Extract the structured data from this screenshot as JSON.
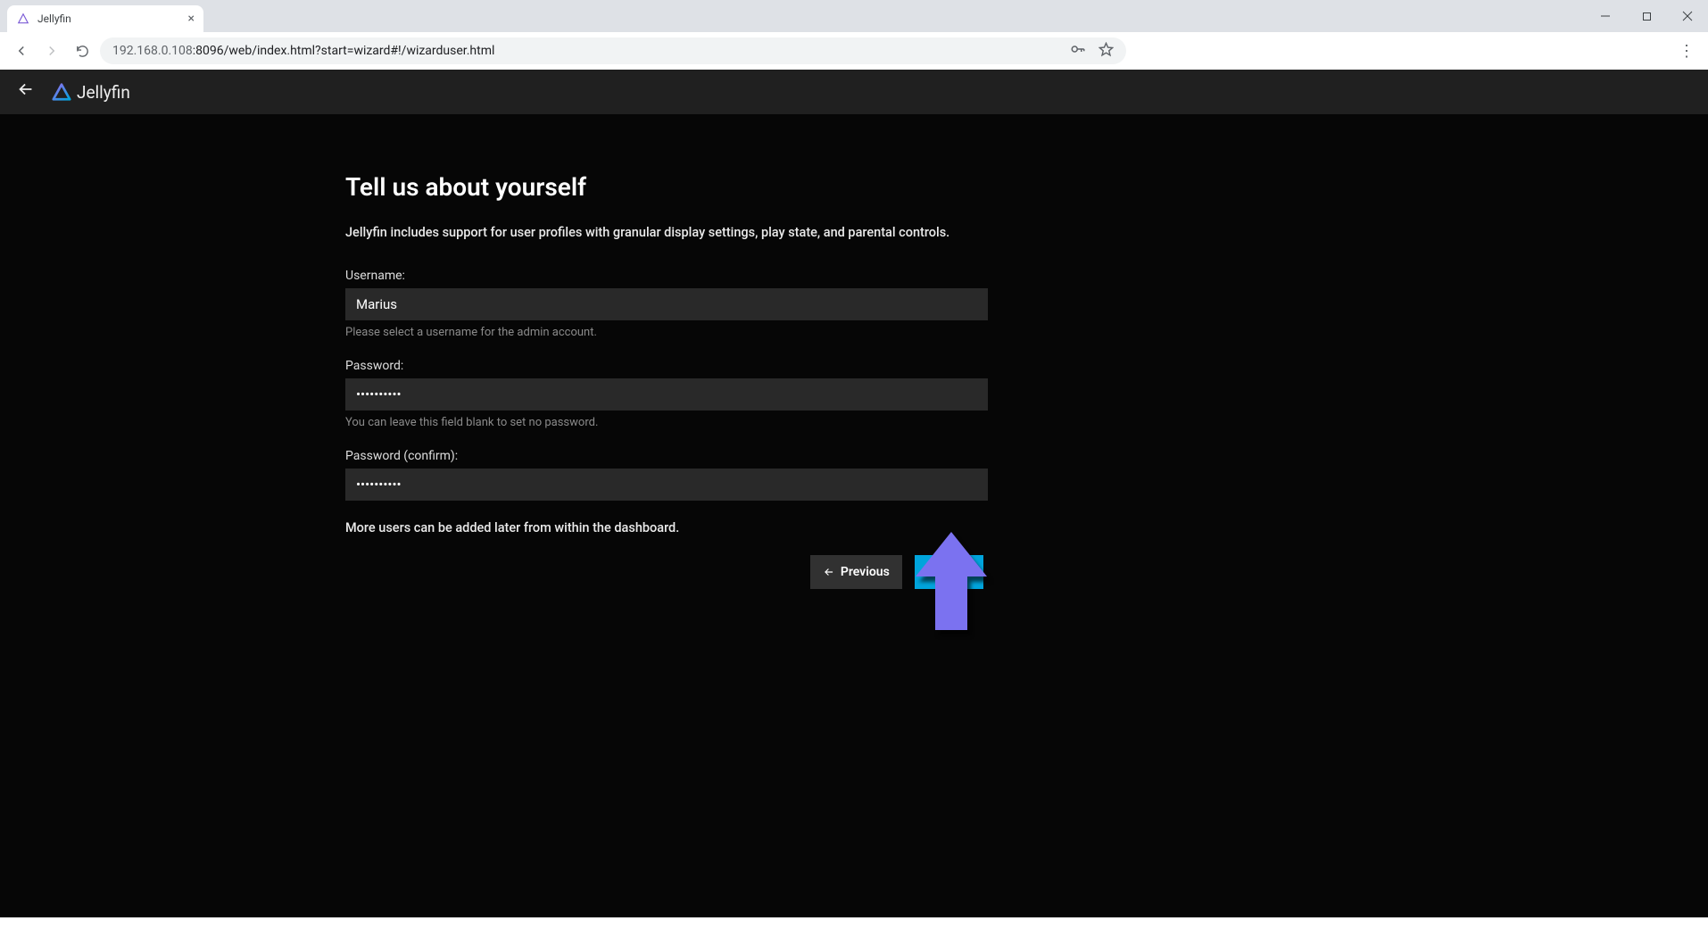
{
  "browser": {
    "tab_title": "Jellyfin",
    "url_dim": "192.168.0.108",
    "url_rest": ":8096/web/index.html?start=wizard#!/wizarduser.html"
  },
  "header": {
    "brand": "Jellyfin"
  },
  "page": {
    "title": "Tell us about yourself",
    "subtitle": "Jellyfin includes support for user profiles with granular display settings, play state, and parental controls.",
    "username_label": "Username:",
    "username_value": "Marius",
    "username_help": "Please select a username for the admin account.",
    "password_label": "Password:",
    "password_value": "••••••••••",
    "password_help": "You can leave this field blank to set no password.",
    "password_confirm_label": "Password (confirm):",
    "password_confirm_value": "••••••••••",
    "more_users_note": "More users can be added later from within the dashboard.",
    "previous": "Previous",
    "next": "Next"
  }
}
